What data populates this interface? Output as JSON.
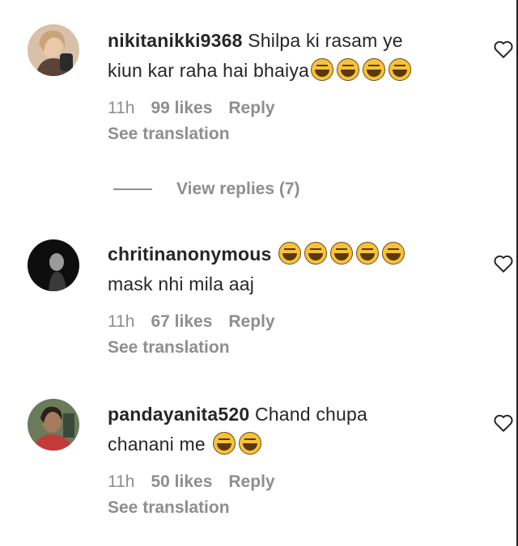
{
  "comments": [
    {
      "username": "nikitanikki9368",
      "text_line1": "Shilpa ki rasam ye",
      "text_line2": "kiun kar raha hai bhaiya",
      "emoji": [
        "😂",
        "😂",
        "😂",
        "😂"
      ],
      "time": "11h",
      "likes": "99 likes",
      "reply": "Reply",
      "translation": "See translation",
      "avatar_color": "#b88a6a"
    },
    {
      "username": "chritinanonymous",
      "emoji": [
        "😂",
        "😂",
        "😂",
        "😂",
        "😂"
      ],
      "text_line2": "mask nhi mila aaj",
      "time": "11h",
      "likes": "67 likes",
      "reply": "Reply",
      "translation": "See translation",
      "avatar_color": "#1c1c1c"
    },
    {
      "username": "pandayanita520",
      "text_line1": "Chand chupa",
      "text_line2": "chanani me",
      "emoji": [
        "😂",
        "😂"
      ],
      "time": "11h",
      "likes": "50 likes",
      "reply": "Reply",
      "translation": "See translation",
      "avatar_color": "#7a5a4a"
    }
  ],
  "view_replies": "View replies (7)",
  "colors": {
    "meta": "#8e8e8e",
    "text": "#262626"
  }
}
